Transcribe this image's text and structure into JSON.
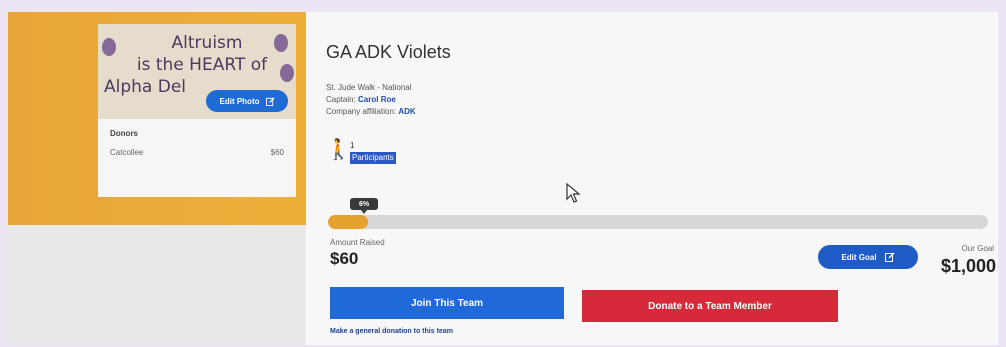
{
  "photo": {
    "line1": "Altruism",
    "line2": "is the HEART  of",
    "line3": "Alpha Del",
    "edit_label": "Edit Photo"
  },
  "donors": {
    "title": "Donors",
    "rows": [
      {
        "name": "Catcollee",
        "amount": "$60"
      }
    ]
  },
  "team": {
    "name": "GA ADK Violets",
    "event": "St. Jude Walk - National",
    "captain_label": "Captain:",
    "captain_name": "Carol Roe",
    "affiliation_label": "Company affiliation:",
    "affiliation_value": "ADK",
    "participant_count": "1",
    "participant_word": "Participants"
  },
  "progress": {
    "percent_label": "6%",
    "fraction": 0.06
  },
  "amounts": {
    "raised_label": "Amount Raised",
    "raised_value": "$60",
    "goal_label": "Our Goal",
    "goal_value": "$1,000",
    "edit_goal_label": "Edit Goal"
  },
  "actions": {
    "join_label": "Join This Team",
    "donate_label": "Donate to a Team Member",
    "general_label": "Make a general donation to this team"
  },
  "colors": {
    "banner": "#f0b23b",
    "primary_blue": "#1f6ad8",
    "donate_red": "#d62a3a",
    "progress_fill": "#e6a22e"
  }
}
